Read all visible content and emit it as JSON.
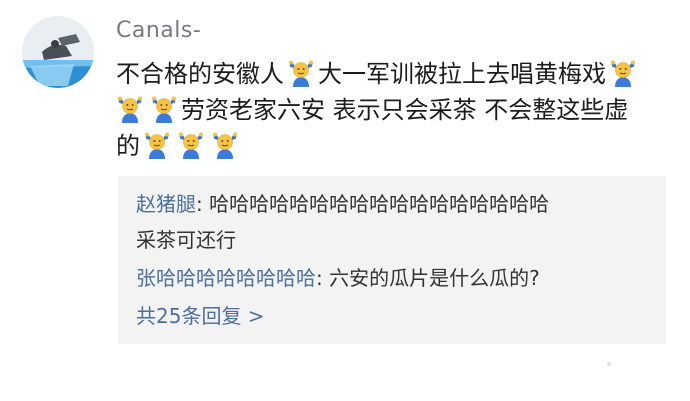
{
  "comment": {
    "username": "Canals-",
    "line1": {
      "before": "不合格的安徽人",
      "after": "大一军训被拉上去唱黄梅戏"
    },
    "line2": {
      "after": "劳资老家六安 表示只会采茶 不会整这些虚"
    },
    "line3": {
      "before": "的"
    },
    "emoji_icon": "shrug-emoji-icon"
  },
  "replies": {
    "items": [
      {
        "name": "赵猪腿",
        "sep": ": ",
        "text": "哈哈哈哈哈哈哈哈哈哈哈哈哈哈哈哈哈",
        "text2": "采茶可还行"
      },
      {
        "name": "张哈哈哈哈哈哈哈哈",
        "sep": ": ",
        "text": "六安的瓜片是什么瓜的?"
      }
    ],
    "more_label": "共25条回复 >"
  },
  "colors": {
    "link_blue": "#4b6f9e",
    "username_gray": "#767a80",
    "reply_bg": "#f3f3f3"
  }
}
